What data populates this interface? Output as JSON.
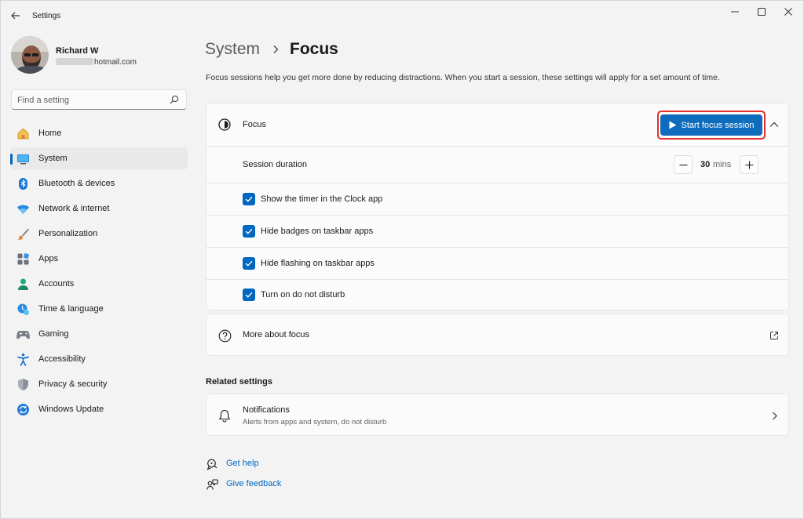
{
  "window": {
    "title": "Settings"
  },
  "profile": {
    "name": "Richard W",
    "email_suffix": "hotmail.com"
  },
  "search": {
    "placeholder": "Find a setting"
  },
  "sidebar": {
    "items": [
      {
        "label": "Home",
        "icon": "home-icon"
      },
      {
        "label": "System",
        "icon": "system-icon",
        "selected": true
      },
      {
        "label": "Bluetooth & devices",
        "icon": "bluetooth-icon"
      },
      {
        "label": "Network & internet",
        "icon": "wifi-icon"
      },
      {
        "label": "Personalization",
        "icon": "brush-icon"
      },
      {
        "label": "Apps",
        "icon": "apps-icon"
      },
      {
        "label": "Accounts",
        "icon": "accounts-icon"
      },
      {
        "label": "Time & language",
        "icon": "time-language-icon"
      },
      {
        "label": "Gaming",
        "icon": "gamepad-icon"
      },
      {
        "label": "Accessibility",
        "icon": "accessibility-icon"
      },
      {
        "label": "Privacy & security",
        "icon": "shield-icon"
      },
      {
        "label": "Windows Update",
        "icon": "update-icon"
      }
    ]
  },
  "breadcrumb": {
    "parent": "System",
    "current": "Focus"
  },
  "description": "Focus sessions help you get more done by reducing distractions. When you start a session, these settings will apply for a set amount of time.",
  "focus_card": {
    "title": "Focus",
    "start_button": "Start focus session",
    "duration_label": "Session duration",
    "duration_value": "30",
    "duration_unit": "mins",
    "options": [
      {
        "label": "Show the timer in the Clock app",
        "checked": true
      },
      {
        "label": "Hide badges on taskbar apps",
        "checked": true
      },
      {
        "label": "Hide flashing on taskbar apps",
        "checked": true
      },
      {
        "label": "Turn on do not disturb",
        "checked": true
      }
    ]
  },
  "more_about": {
    "label": "More about focus"
  },
  "related": {
    "title": "Related settings",
    "notifications": {
      "title": "Notifications",
      "subtitle": "Alerts from apps and system, do not disturb"
    }
  },
  "help": {
    "get_help": "Get help",
    "give_feedback": "Give feedback"
  },
  "colors": {
    "accent": "#0067c0",
    "button": "#0f6cbd",
    "highlight_outline": "#e2322a",
    "background": "#f3f3f3",
    "card": "#fbfbfb"
  }
}
